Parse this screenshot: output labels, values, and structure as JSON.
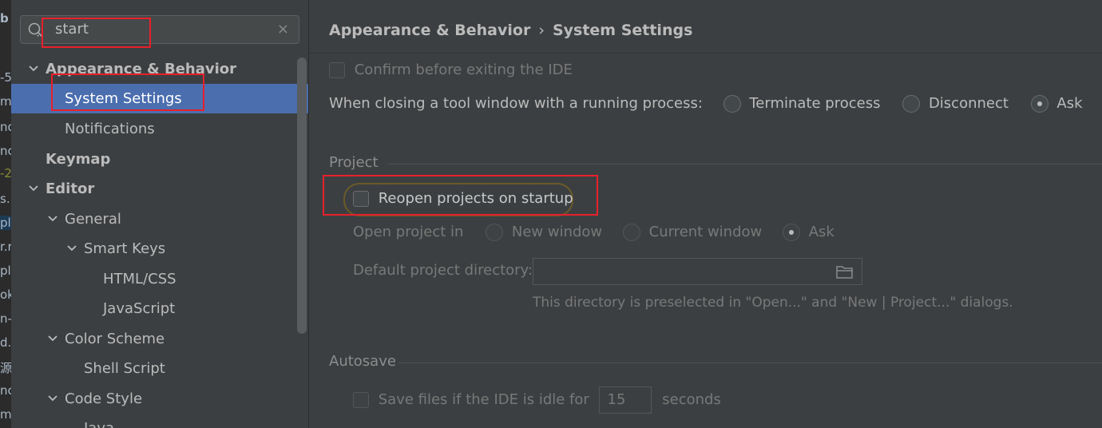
{
  "background_window": {
    "fragments": [
      "b",
      "-5",
      "m",
      "no",
      "nc",
      "-2",
      "s.",
      "plu",
      "r.r",
      "pl",
      "ok",
      "n-",
      "d.",
      "源",
      "nc",
      "m"
    ]
  },
  "search": {
    "value": "start",
    "placeholder": "",
    "clear_symbol": "×"
  },
  "tree": {
    "appearance_behavior": "Appearance & Behavior",
    "system_settings": "System Settings",
    "notifications": "Notifications",
    "keymap": "Keymap",
    "editor": "Editor",
    "general": "General",
    "smart_keys": "Smart Keys",
    "html_css": "HTML/CSS",
    "javascript": "JavaScript",
    "color_scheme": "Color Scheme",
    "shell_script": "Shell Script",
    "code_style": "Code Style",
    "java": "Java"
  },
  "breadcrumb": {
    "parent": "Appearance & Behavior",
    "separator": "›",
    "current": "System Settings"
  },
  "settings": {
    "confirm_exit": {
      "label": "Confirm before exiting the IDE",
      "checked": false
    },
    "closing_tool_window": {
      "label": "When closing a tool window with a running process:",
      "options": [
        "Terminate process",
        "Disconnect",
        "Ask"
      ],
      "selected": "Ask"
    },
    "project_section": "Project",
    "reopen_projects": {
      "label": "Reopen projects on startup",
      "checked": false
    },
    "open_project_in": {
      "label": "Open project in",
      "options": [
        "New window",
        "Current window",
        "Ask"
      ],
      "selected": "Ask"
    },
    "default_dir": {
      "label": "Default project directory:",
      "value": "",
      "hint": "This directory is preselected in \"Open...\" and \"New | Project...\" dialogs."
    },
    "autosave_section": "Autosave",
    "save_idle": {
      "label": "Save files if the IDE is idle for",
      "value": "15",
      "unit": "seconds",
      "checked": false
    }
  },
  "colors": {
    "selection": "#4b6eaf",
    "highlight_box": "#e8202b",
    "panel_bg": "#3c3f41"
  }
}
